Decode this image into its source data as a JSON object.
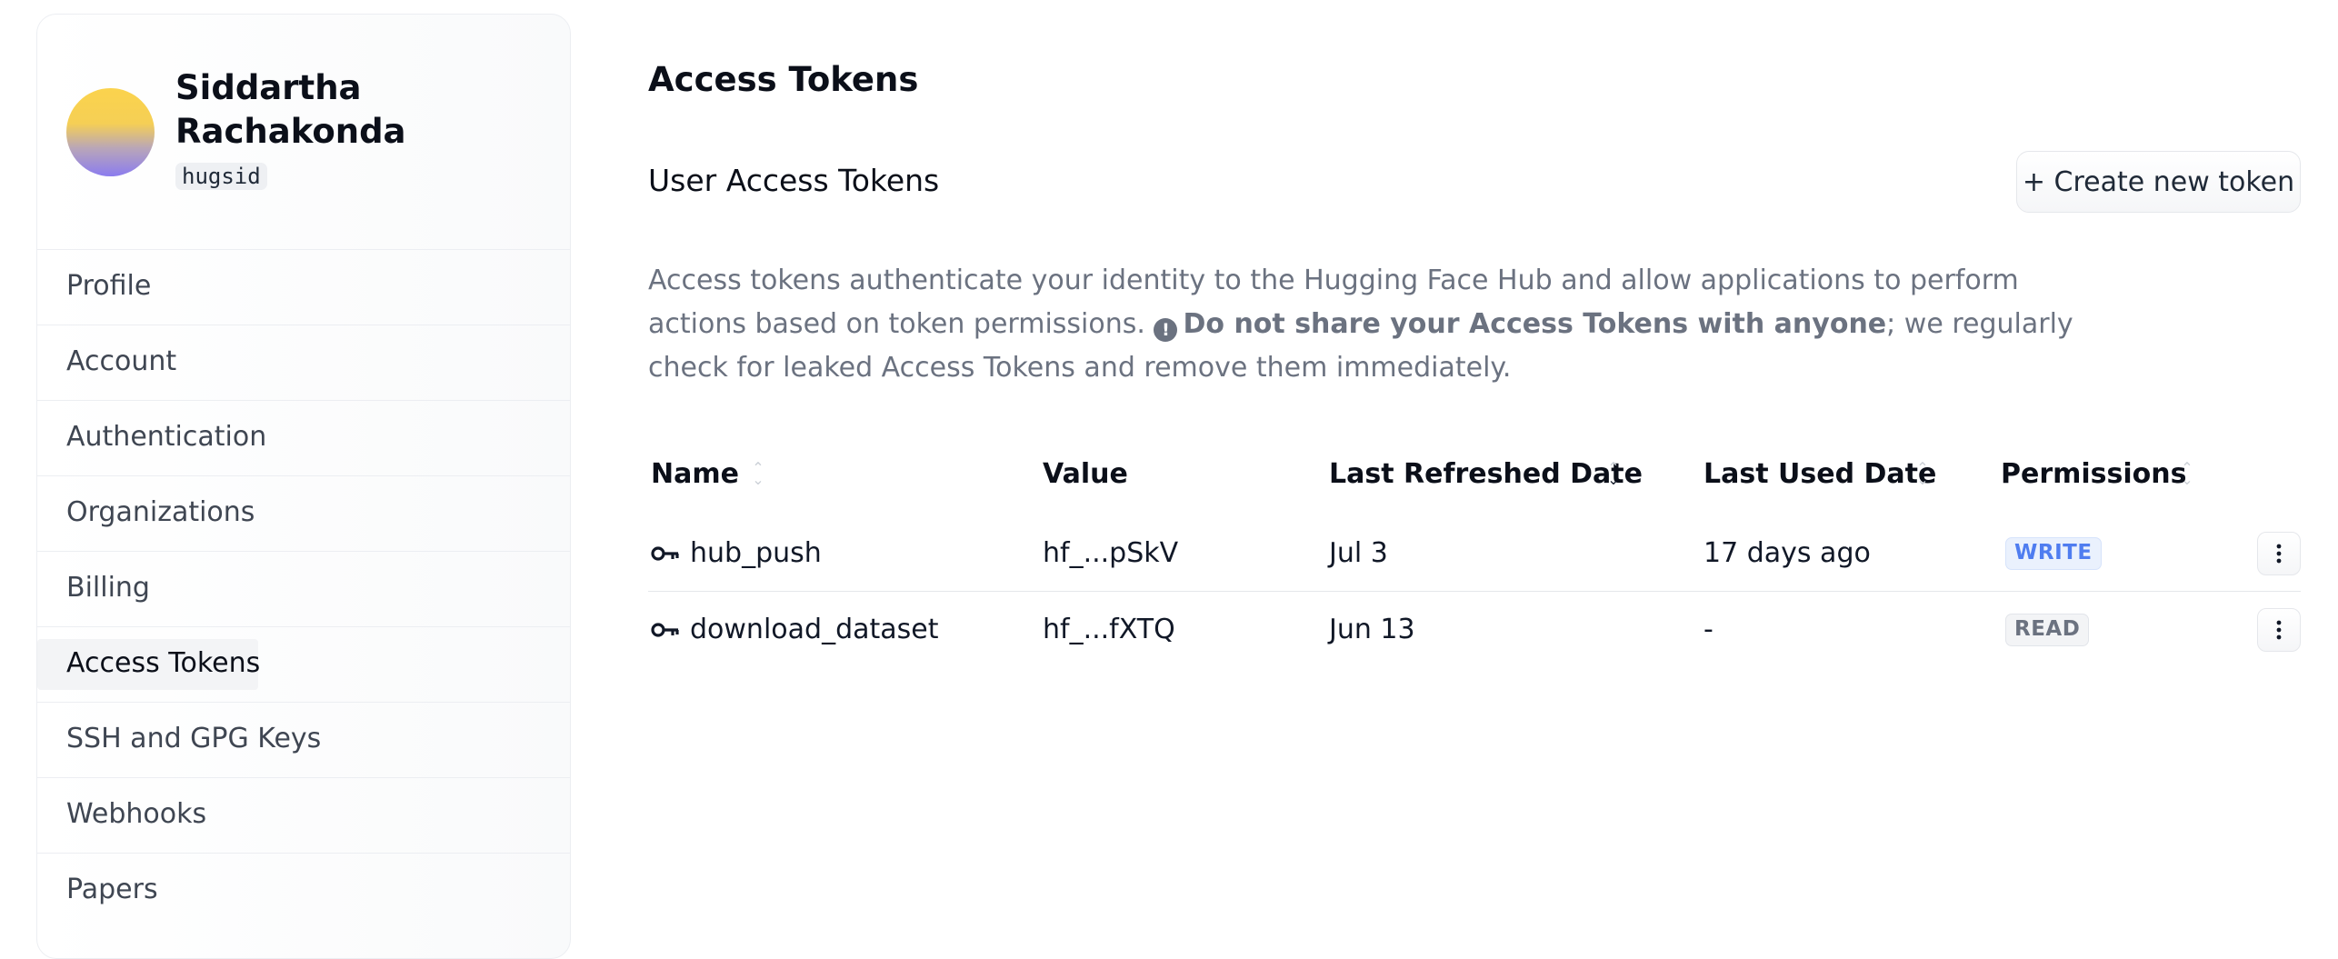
{
  "user": {
    "name_line1": "Siddartha",
    "name_line2": "Rachakonda",
    "handle": "hugsid"
  },
  "sidebar": {
    "items": [
      {
        "label": "Profile"
      },
      {
        "label": "Account"
      },
      {
        "label": "Authentication"
      },
      {
        "label": "Organizations"
      },
      {
        "label": "Billing"
      },
      {
        "label": "Access Tokens",
        "active": true
      },
      {
        "label": "SSH and GPG Keys"
      },
      {
        "label": "Webhooks"
      },
      {
        "label": "Papers"
      }
    ]
  },
  "main": {
    "title": "Access Tokens",
    "section_title": "User Access Tokens",
    "create_button": "+ Create new token",
    "description": {
      "part1": "Access tokens authenticate your identity to the Hugging Face Hub and allow applications to perform actions based on token permissions.",
      "warning_icon": "!",
      "bold": "Do not share your Access Tokens with anyone",
      "part2": "; we regularly check for leaked Access Tokens and remove them immediately."
    }
  },
  "table": {
    "columns": [
      "Name",
      "Value",
      "Last Refreshed Date",
      "Last Used Date",
      "Permissions"
    ],
    "rows": [
      {
        "name": "hub_push",
        "value": "hf_...pSkV",
        "refreshed": "Jul 3",
        "last_used": "17 days ago",
        "permission": "WRITE"
      },
      {
        "name": "download_dataset",
        "value": "hf_...fXTQ",
        "refreshed": "Jun 13",
        "last_used": "-",
        "permission": "READ"
      }
    ]
  },
  "icons": {
    "sort": "sort-icon",
    "key": "key-icon",
    "menu": "kebab-menu-icon",
    "warning": "exclamation-circle-icon"
  },
  "colors": {
    "write_badge": "#4f7df0",
    "read_badge": "#6b7280",
    "text_muted": "#6b7280"
  }
}
